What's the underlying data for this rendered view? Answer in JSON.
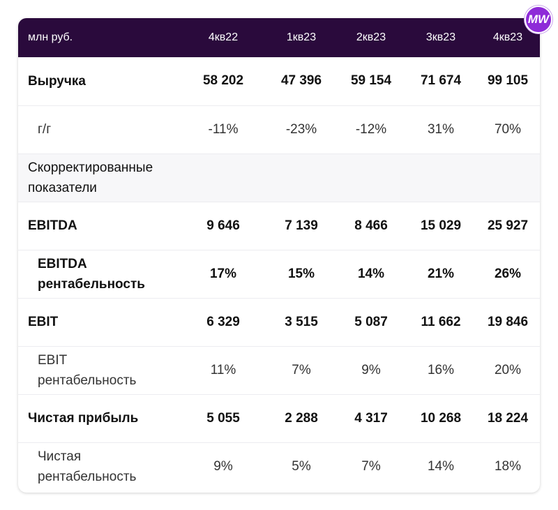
{
  "logo": {
    "text": "MW",
    "color": "#8e2bd8"
  },
  "colors": {
    "header_bg": "#2a0a3c",
    "section_bg": "#f7f7f9"
  },
  "header": {
    "unit": "млн руб.",
    "columns": [
      "4кв22",
      "1кв23",
      "2кв23",
      "3кв23",
      "4кв23"
    ]
  },
  "rows": [
    {
      "label": "Выручка",
      "values": [
        "58 202",
        "47 396",
        "59 154",
        "71 674",
        "99 105"
      ]
    },
    {
      "label": "г/г",
      "values": [
        "-11%",
        "-23%",
        "-12%",
        "31%",
        "70%"
      ]
    },
    {
      "label": "Скорректированные показатели",
      "values": [
        "",
        "",
        "",
        "",
        ""
      ]
    },
    {
      "label": "EBITDA",
      "values": [
        "9 646",
        "7 139",
        "8 466",
        "15 029",
        "25 927"
      ]
    },
    {
      "label": "EBITDA рентабельность",
      "values": [
        "17%",
        "15%",
        "14%",
        "21%",
        "26%"
      ]
    },
    {
      "label": "EBIT",
      "values": [
        "6 329",
        "3 515",
        "5 087",
        "11 662",
        "19 846"
      ]
    },
    {
      "label": "EBIT рентабельность",
      "values": [
        "11%",
        "7%",
        "9%",
        "16%",
        "20%"
      ]
    },
    {
      "label": "Чистая прибыль",
      "values": [
        "5 055",
        "2 288",
        "4 317",
        "10 268",
        "18 224"
      ]
    },
    {
      "label": "Чистая рентабельность",
      "values": [
        "9%",
        "5%",
        "7%",
        "14%",
        "18%"
      ]
    }
  ]
}
